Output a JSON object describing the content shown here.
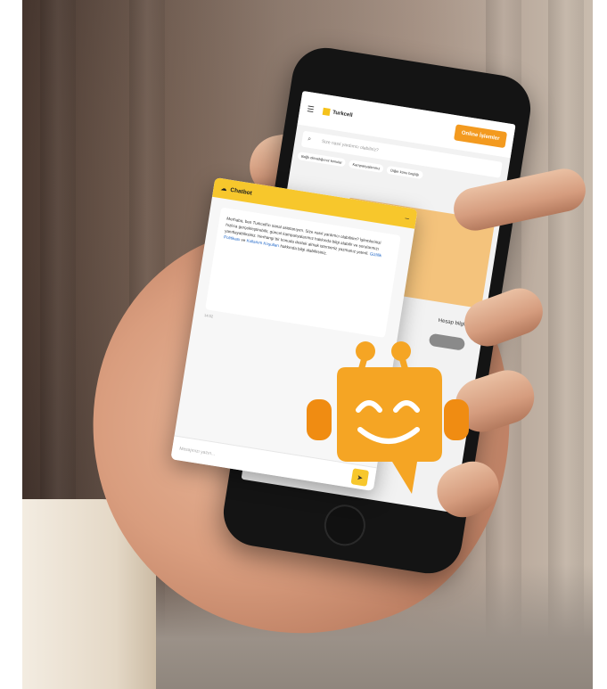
{
  "scene": {
    "description_colors": {
      "accent": "#f39a1f",
      "chat_header": "#f7c72c",
      "robot_orange": "#f5a524",
      "robot_dark": "#e08a10"
    }
  },
  "website": {
    "logo_text": "Turkcell",
    "header_button": "Online İşlemler",
    "search_placeholder": "Size nasıl yardımcı olabiliriz?",
    "chips": [
      "Bağlı olmadığımız konular",
      "Kampanyalarımız",
      "Diğer konu başlığı"
    ],
    "section_label": "Hesap bilgileri ›",
    "icons": {
      "menu": "menu-icon",
      "search": "search-icon"
    }
  },
  "chat": {
    "title": "Chatbot",
    "toggle": "–",
    "message_start": "Merhaba, ben Turkcell'in sanal asistanıyım. Size nasıl yardımcı olabilirim? İşlemlerinizi hızlıca gerçekleştirebilir, güncel kampanyalarımız hakkında bilgi alabilir ve sorularınızı yanıtlayabilirsiniz. Herhangi bir konuda destek almak isterseniz yazmanız yeterli. ",
    "link1": "Gizlilik Politikası",
    "message_middle": " ve ",
    "link2": "Kullanım Koşulları",
    "message_end": " hakkında bilgi alabilirsiniz.",
    "timestamp": "14:02",
    "input_placeholder": "Mesajınızı yazın...",
    "send_icon": "send-icon"
  },
  "mascot": {
    "icon": "robot-chatbot-icon"
  }
}
